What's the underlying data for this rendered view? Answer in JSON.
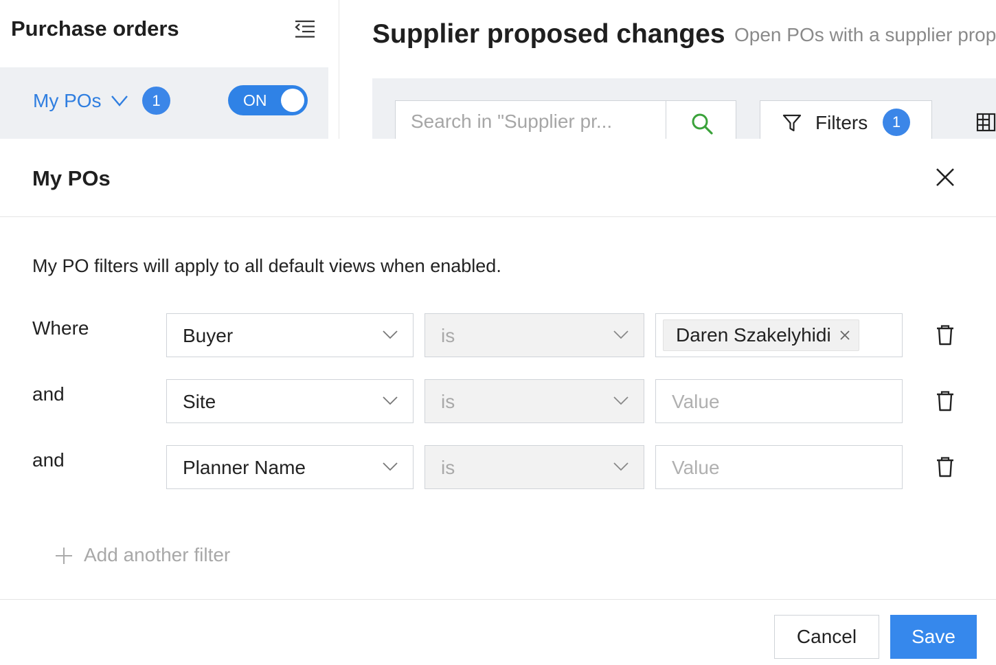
{
  "sidebar": {
    "title": "Purchase orders",
    "my_pos_label": "My POs",
    "my_pos_badge": "1",
    "toggle_label": "ON"
  },
  "main": {
    "title": "Supplier proposed changes",
    "subtitle": "Open POs with a supplier prop",
    "search_placeholder": "Search in \"Supplier pr...",
    "filters_label": "Filters",
    "filters_badge": "1"
  },
  "modal": {
    "title": "My POs",
    "description": "My PO filters will apply to all default views when enabled.",
    "rows": [
      {
        "connector": "Where",
        "field": "Buyer",
        "operator": "is",
        "value_chip": "Daren Szakelyhidi",
        "value_placeholder": ""
      },
      {
        "connector": "and",
        "field": "Site",
        "operator": "is",
        "value_chip": "",
        "value_placeholder": "Value"
      },
      {
        "connector": "and",
        "field": "Planner Name",
        "operator": "is",
        "value_chip": "",
        "value_placeholder": "Value"
      }
    ],
    "add_filter_label": "Add another filter",
    "cancel_label": "Cancel",
    "save_label": "Save"
  },
  "colors": {
    "accent": "#3688ec",
    "toggle_on": "#2f82e6",
    "search_icon": "#3aa23a",
    "panel_bg": "#eef0f3"
  },
  "icons": [
    "collapse-menu-icon",
    "chevron-down-icon",
    "search-icon",
    "funnel-icon",
    "columns-icon",
    "close-icon",
    "remove-chip-icon",
    "trash-icon",
    "plus-icon"
  ]
}
